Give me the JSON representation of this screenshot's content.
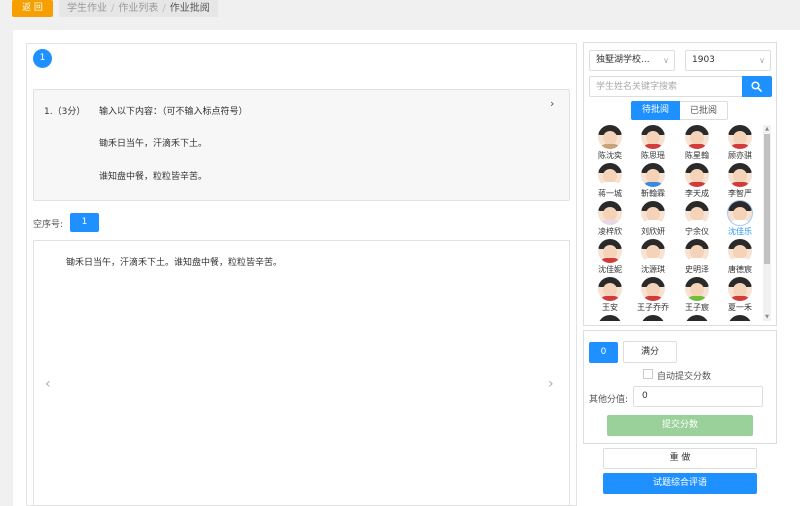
{
  "topbar": {
    "back_label": "返 回",
    "breadcrumb": [
      "学生作业",
      "作业列表",
      "作业批阅"
    ]
  },
  "question": {
    "number": "1",
    "score_label": "1.（3分）",
    "prompt": "输入以下内容：（可不输入标点符号）",
    "line1": "锄禾日当午，汗滴禾下土。",
    "line2": "谁知盘中餐，粒粒皆辛苦。"
  },
  "blank": {
    "label": "空序号:",
    "value": "1"
  },
  "answer": {
    "text": "锄禾日当午，汗滴禾下土。谁知盘中餐，粒粒皆辛苦。"
  },
  "filters": {
    "school": "独墅湖学校...",
    "class": "1903",
    "search_placeholder": "学生姓名关键字搜索"
  },
  "tabs": {
    "pending": "待批阅",
    "done": "已批阅"
  },
  "students": [
    {
      "name": "陈沈奕",
      "shirt": "#c9a27a",
      "selected": false
    },
    {
      "name": "陈思瑶",
      "shirt": "#d33b3b",
      "selected": false
    },
    {
      "name": "陈星翰",
      "shirt": "#d33b3b",
      "selected": false
    },
    {
      "name": "顾亦骐",
      "shirt": "#d33b3b",
      "selected": false
    },
    {
      "name": "蒋一城",
      "shirt": "#ffffff",
      "selected": false
    },
    {
      "name": "靳翰霖",
      "shirt": "#3a8be0",
      "selected": false
    },
    {
      "name": "李天成",
      "shirt": "#d33b3b",
      "selected": false
    },
    {
      "name": "李智严",
      "shirt": "#d33b3b",
      "selected": false
    },
    {
      "name": "凌梓欣",
      "shirt": "#e8d9e8",
      "selected": false
    },
    {
      "name": "刘欣妍",
      "shirt": "#ffffff",
      "selected": false
    },
    {
      "name": "宁余仪",
      "shirt": "#ffffff",
      "selected": false
    },
    {
      "name": "沈佳乐",
      "shirt": "#ffffff",
      "selected": true
    },
    {
      "name": "沈佳妮",
      "shirt": "#d33b3b",
      "selected": false
    },
    {
      "name": "沈源琪",
      "shirt": "#ffffff",
      "selected": false
    },
    {
      "name": "史明泽",
      "shirt": "#ffffff",
      "selected": false
    },
    {
      "name": "唐德宸",
      "shirt": "#ffffff",
      "selected": false
    },
    {
      "name": "王安",
      "shirt": "#d33b3b",
      "selected": false
    },
    {
      "name": "王子乔乔",
      "shirt": "#d33b3b",
      "selected": false
    },
    {
      "name": "王子宸",
      "shirt": "#6fbf3a",
      "selected": false
    },
    {
      "name": "夏一禾",
      "shirt": "#d33b3b",
      "selected": false
    }
  ],
  "scoring": {
    "zero": "0",
    "full": "满分",
    "auto_submit": "自动提交分数",
    "other_label": "其他分值:",
    "other_value": "0",
    "submit": "提交分数"
  },
  "actions": {
    "redo": "重 做",
    "comment": "试题综合评语"
  },
  "colors": {
    "accent": "#1e90ff",
    "back": "#f5a000",
    "submit_disabled": "#9ad19a"
  }
}
